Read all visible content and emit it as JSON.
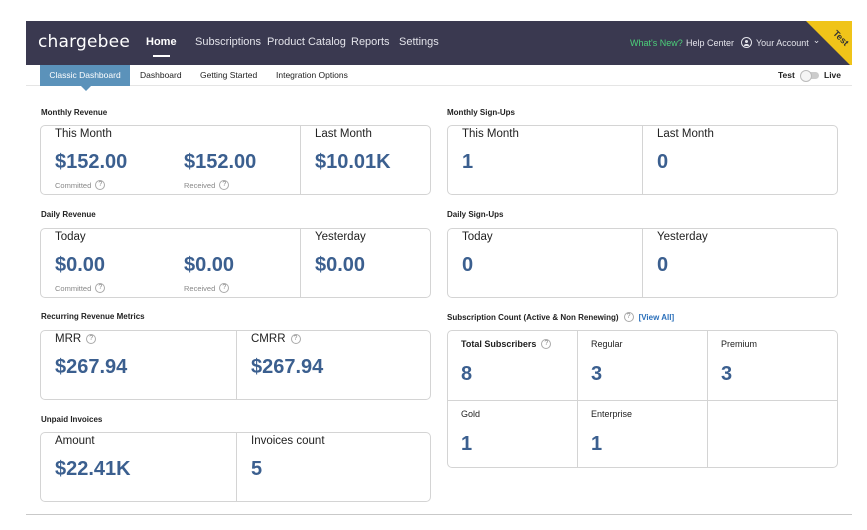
{
  "nav": {
    "logo": "chargebee",
    "items": [
      "Home",
      "Subscriptions",
      "Product Catalog",
      "Reports",
      "Settings"
    ],
    "whats_new": "What's New?",
    "help_center": "Help Center",
    "account": "Your Account",
    "test_badge": "Test"
  },
  "subnav": {
    "tabs": [
      "Classic Dashboard",
      "Dashboard",
      "Getting Started",
      "Integration Options"
    ],
    "mode_test": "Test",
    "mode_live": "Live"
  },
  "monthly_revenue": {
    "title": "Monthly Revenue",
    "this_month_label": "This Month",
    "committed_value": "$152.00",
    "committed_label": "Committed",
    "received_value": "$152.00",
    "received_label": "Received",
    "last_month_label": "Last Month",
    "last_month_value": "$10.01K"
  },
  "daily_revenue": {
    "title": "Daily Revenue",
    "today_label": "Today",
    "committed_value": "$0.00",
    "committed_label": "Committed",
    "received_value": "$0.00",
    "received_label": "Received",
    "yesterday_label": "Yesterday",
    "yesterday_value": "$0.00"
  },
  "recurring": {
    "title": "Recurring Revenue Metrics",
    "mrr_label": "MRR",
    "mrr_value": "$267.94",
    "cmrr_label": "CMRR",
    "cmrr_value": "$267.94"
  },
  "unpaid": {
    "title": "Unpaid Invoices",
    "amount_label": "Amount",
    "amount_value": "$22.41K",
    "count_label": "Invoices count",
    "count_value": "5"
  },
  "monthly_signups": {
    "title": "Monthly Sign-Ups",
    "this_month_label": "This Month",
    "this_month_value": "1",
    "last_month_label": "Last Month",
    "last_month_value": "0"
  },
  "daily_signups": {
    "title": "Daily Sign-Ups",
    "today_label": "Today",
    "today_value": "0",
    "yesterday_label": "Yesterday",
    "yesterday_value": "0"
  },
  "subscription_count": {
    "title": "Subscription Count (Active & Non Renewing)",
    "view_all": "[View All]",
    "cells": [
      {
        "label": "Total Subscribers",
        "value": "8"
      },
      {
        "label": "Regular",
        "value": "3"
      },
      {
        "label": "Premium",
        "value": "3"
      },
      {
        "label": "Gold",
        "value": "1"
      },
      {
        "label": "Enterprise",
        "value": "1"
      }
    ]
  },
  "icons": {
    "help": "?",
    "chevron": "⌄"
  }
}
